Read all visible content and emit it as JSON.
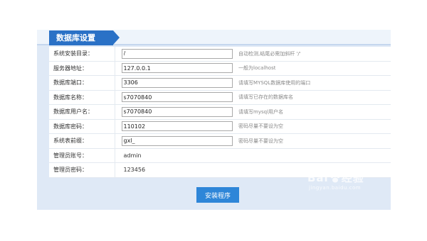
{
  "header": {
    "title": "数据库设置"
  },
  "rows": [
    {
      "label": "系统安装目录：",
      "value": "/",
      "hint": "自动检测,结尾必需加斜杆 '/'"
    },
    {
      "label": "服务器地址：",
      "value": "127.0.0.1",
      "hint": "一般为localhost"
    },
    {
      "label": "数据库端口：",
      "value": "3306",
      "hint": "请填写MYSQL数据库使用的端口"
    },
    {
      "label": "数据库名称：",
      "value": "s7070840",
      "hint": "请填写已存在的数据库名"
    },
    {
      "label": "数据库用户名：",
      "value": "s7070840",
      "hint": "请填写mysql用户名"
    },
    {
      "label": "数据库密码：",
      "value": "110102",
      "hint": "密码尽量不要设为空"
    },
    {
      "label": "系统表前缀：",
      "value": "gxl_",
      "hint": "密码尽量不要设为空"
    },
    {
      "label": "管理员账号：",
      "value": "admin"
    },
    {
      "label": "管理员密码：",
      "value": "123456"
    }
  ],
  "submit_label": "安装程序",
  "watermark": {
    "brand": "Bai",
    "brand2": "经验",
    "url": "jingyan.baidu.com",
    "icon": "paw-icon"
  },
  "colors": {
    "panel_bg": "#dfe9f6",
    "tab_blue": "#2a71c6",
    "button_blue": "#2e86d8"
  }
}
